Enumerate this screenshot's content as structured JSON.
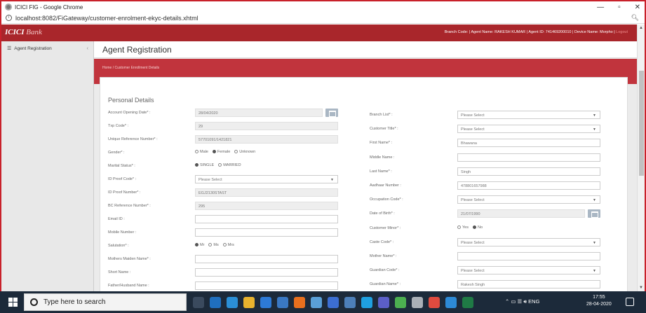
{
  "browser": {
    "title": "ICICI FIG - Google Chrome",
    "url": "localhost:8082/FiGateway/customer-enrolment-ekyc-details.xhtml",
    "controls": {
      "minimize": "—",
      "restore": "▫",
      "close": "✕"
    }
  },
  "header": {
    "logo_main": "ICICI",
    "logo_sub": "Bank",
    "userinfo": "Branch Code: | Agent Name: RAKESH KUMAR | Agent ID: 741469200010 | Device Name: Morpho |",
    "logout": "Logout"
  },
  "sidebar": {
    "items": [
      {
        "label": "Agent Registration",
        "icon": "menu-icon"
      }
    ]
  },
  "page": {
    "title": "Agent Registration",
    "breadcrumb_home": "Home",
    "breadcrumb_sep": "/",
    "breadcrumb_current": "Customer Enrollment Details",
    "section_title": "Personal Details"
  },
  "left_fields": [
    {
      "label": "Account Opening Date* :",
      "value": "28/04/2020",
      "kind": "readonly-cal"
    },
    {
      "label": "Txp Code* :",
      "value": "29",
      "kind": "readonly"
    },
    {
      "label": "Unique Reference Number* :",
      "value": "57701091/1421821",
      "kind": "readonly"
    },
    {
      "label": "Gender* :",
      "kind": "radio",
      "options": [
        "Male",
        "Female",
        "Unknown"
      ],
      "selected": 1
    },
    {
      "label": "Marital Status* :",
      "kind": "radio",
      "options": [
        "SINGLE",
        "MARRIED"
      ],
      "selected": 0
    },
    {
      "label": "ID Proof Code* :",
      "value": "Please Select",
      "kind": "select"
    },
    {
      "label": "ID Proof Number* :",
      "value": "EGJ2130STAST",
      "kind": "readonly"
    },
    {
      "label": "BC Reference Number* :",
      "value": "295",
      "kind": "readonly"
    },
    {
      "label": "Email ID :",
      "value": "",
      "kind": "input"
    },
    {
      "label": "Mobile Number :",
      "value": "",
      "kind": "input"
    },
    {
      "label": "Salutation* :",
      "kind": "radio",
      "options": [
        "Mr",
        "Ms",
        "Mrs"
      ],
      "selected": 0
    },
    {
      "label": "Mothers Maiden Name* :",
      "value": "",
      "kind": "input"
    },
    {
      "label": "Short Name :",
      "value": "",
      "kind": "input"
    },
    {
      "label": "Father/Husband Name :",
      "value": "",
      "kind": "input"
    }
  ],
  "right_fields": [
    {
      "label": "Branch List* :",
      "value": "Please Select",
      "kind": "select"
    },
    {
      "label": "Customer Title* :",
      "value": "Please Select",
      "kind": "select"
    },
    {
      "label": "First Name* :",
      "value": "Bhawana",
      "kind": "input"
    },
    {
      "label": "Middle Name :",
      "value": "",
      "kind": "input"
    },
    {
      "label": "Last Name* :",
      "value": "Singh",
      "kind": "input"
    },
    {
      "label": "Aadhaar Number :",
      "value": "478801657988",
      "kind": "input"
    },
    {
      "label": "Occupation Code* :",
      "value": "Please Select",
      "kind": "select"
    },
    {
      "label": "Date of Birth* :",
      "value": "21/07/1990",
      "kind": "readonly-cal"
    },
    {
      "label": "Customer Minor* :",
      "kind": "radio",
      "options": [
        "Yes",
        "No"
      ],
      "selected": 1
    },
    {
      "label": "Caste Code* :",
      "value": "Please Select",
      "kind": "select"
    },
    {
      "label": "Mother Name* :",
      "value": "",
      "kind": "input"
    },
    {
      "label": "Guardian Code* :",
      "value": "Please Select",
      "kind": "select"
    },
    {
      "label": "Guardian Name* :",
      "value": "Rakesh Singh",
      "kind": "input"
    }
  ],
  "taskbar": {
    "search_placeholder": "Type here to search",
    "tray_text": "ENG",
    "time": "17:55",
    "date": "28-04-2020"
  }
}
